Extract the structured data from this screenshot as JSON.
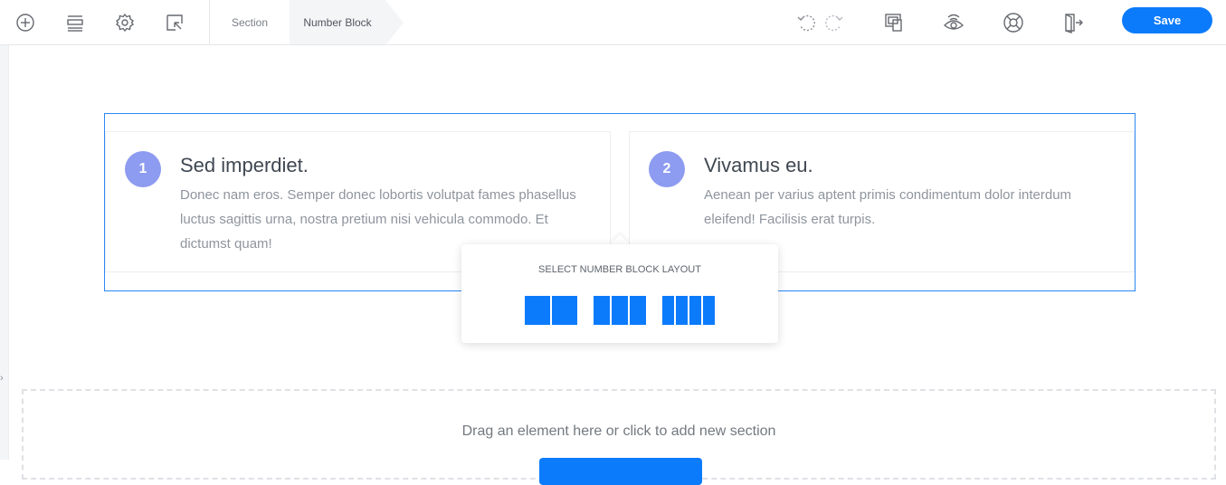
{
  "toolbar": {
    "icons": [
      "add-icon",
      "layers-icon",
      "gear-icon",
      "select-icon"
    ],
    "breadcrumb": [
      "Section",
      "Number Block"
    ],
    "right_icons": [
      "undo-icon",
      "redo-icon",
      "responsive-icon",
      "preview-icon",
      "help-icon",
      "exit-icon"
    ],
    "save_label": "Save"
  },
  "cards": [
    {
      "number": "1",
      "title": "Sed imperdiet.",
      "text": "Donec nam eros. Semper donec lobortis volutpat fames phasellus luctus sagittis urna, nostra pretium nisi vehicula commodo. Et dictumst quam!"
    },
    {
      "number": "2",
      "title": "Vivamus eu.",
      "text": "Aenean per varius aptent primis condimentum dolor interdum eleifend! Facilisis erat turpis."
    }
  ],
  "popup": {
    "title": "SELECT NUMBER BLOCK LAYOUT",
    "options": [
      2,
      3,
      4
    ]
  },
  "drop_zone": {
    "text": "Drag an element here or click to add new section"
  },
  "colors": {
    "accent": "#0c7bfb",
    "circle": "#8d9bf0",
    "frame": "#2a88f5"
  }
}
